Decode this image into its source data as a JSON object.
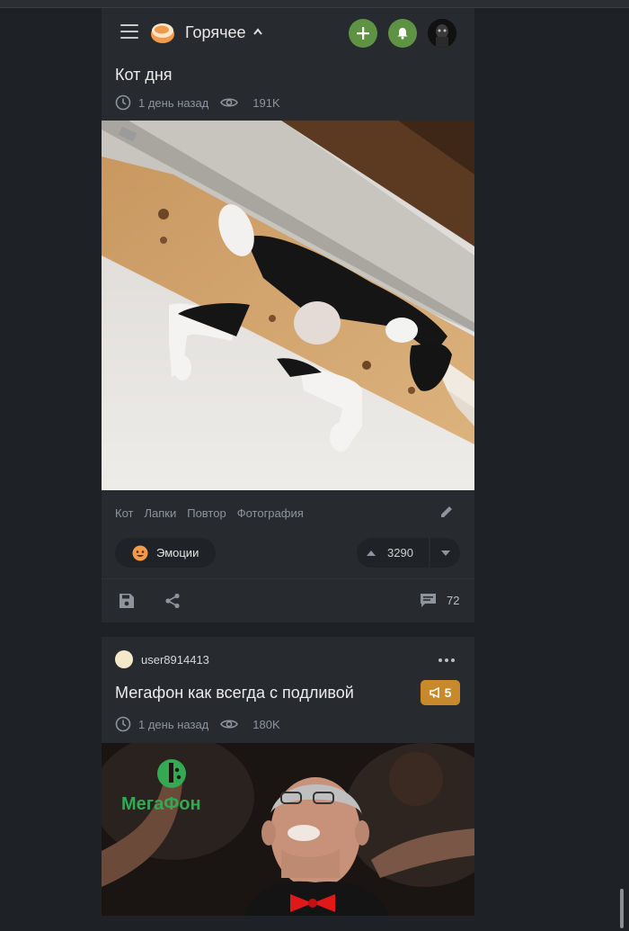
{
  "header": {
    "section": "Горячее",
    "icons": [
      "menu-icon",
      "pikabu-logo",
      "chevron-up-icon",
      "plus-icon",
      "bell-icon",
      "user-avatar"
    ],
    "accent": "#5f9344"
  },
  "post1": {
    "title": "Кот дня",
    "time": "1 день назад",
    "views": "191K",
    "tags": [
      "Кот",
      "Лапки",
      "Повтор",
      "Фотография"
    ],
    "emotions_label": "Эмоции",
    "rating": "3290",
    "comments": "72"
  },
  "post2": {
    "author": "user8914413",
    "title": "Мегафон как всегда с подливой",
    "badge": "5",
    "badge_color": "#c8892c",
    "time": "1 день назад",
    "views": "180K",
    "brand": "МегаФон"
  }
}
